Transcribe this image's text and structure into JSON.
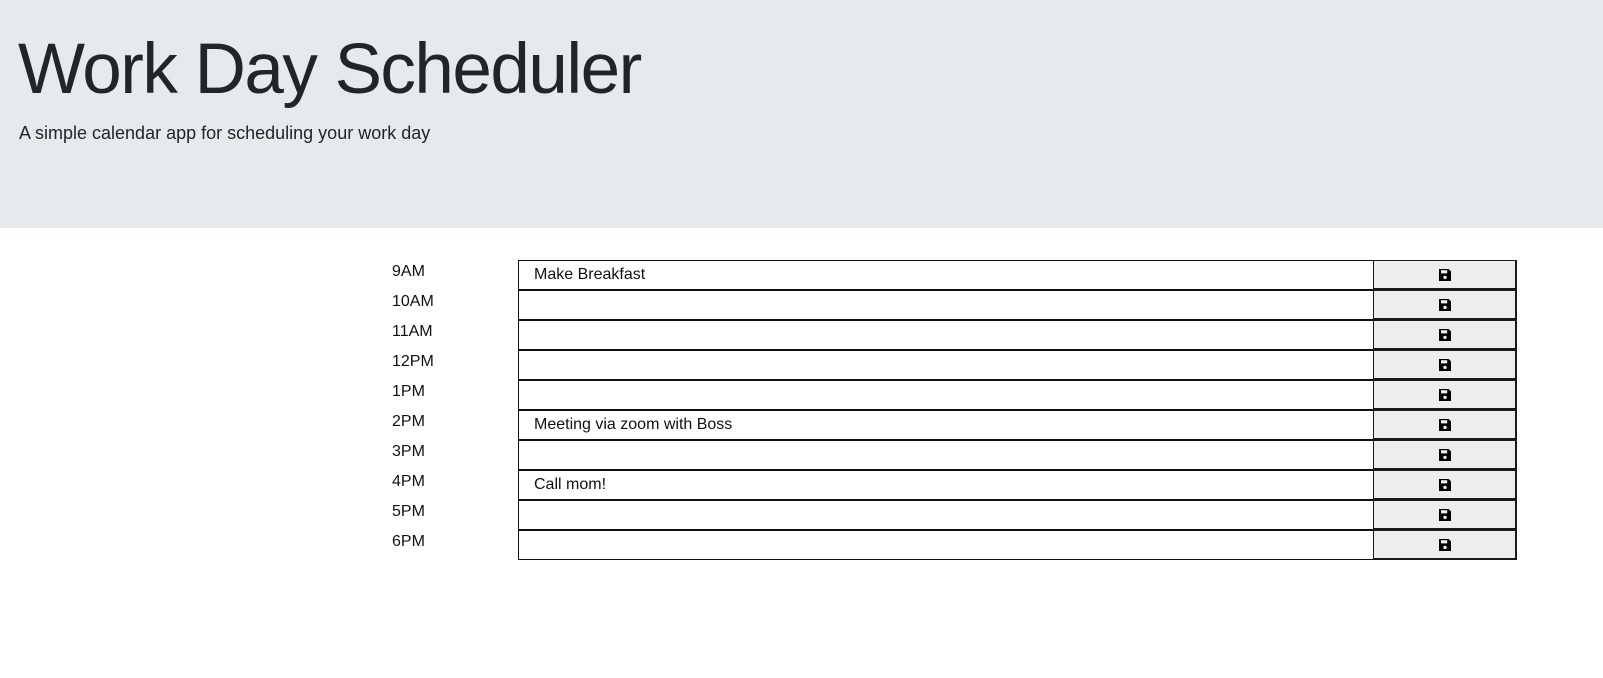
{
  "header": {
    "title": "Work Day Scheduler",
    "subtitle": "A simple calendar app for scheduling your work day"
  },
  "schedule": {
    "save_icon": "floppy-disk-icon",
    "rows": [
      {
        "hour": "9AM",
        "event": "Make Breakfast"
      },
      {
        "hour": "10AM",
        "event": ""
      },
      {
        "hour": "11AM",
        "event": ""
      },
      {
        "hour": "12PM",
        "event": ""
      },
      {
        "hour": "1PM",
        "event": ""
      },
      {
        "hour": "2PM",
        "event": "Meeting via zoom with Boss"
      },
      {
        "hour": "3PM",
        "event": ""
      },
      {
        "hour": "4PM",
        "event": "Call mom!"
      },
      {
        "hour": "5PM",
        "event": ""
      },
      {
        "hour": "6PM",
        "event": ""
      }
    ]
  },
  "colors": {
    "jumbotron_background": "#e6e9ee",
    "save_button_background": "#ededed",
    "border": "#1a1a1a"
  }
}
